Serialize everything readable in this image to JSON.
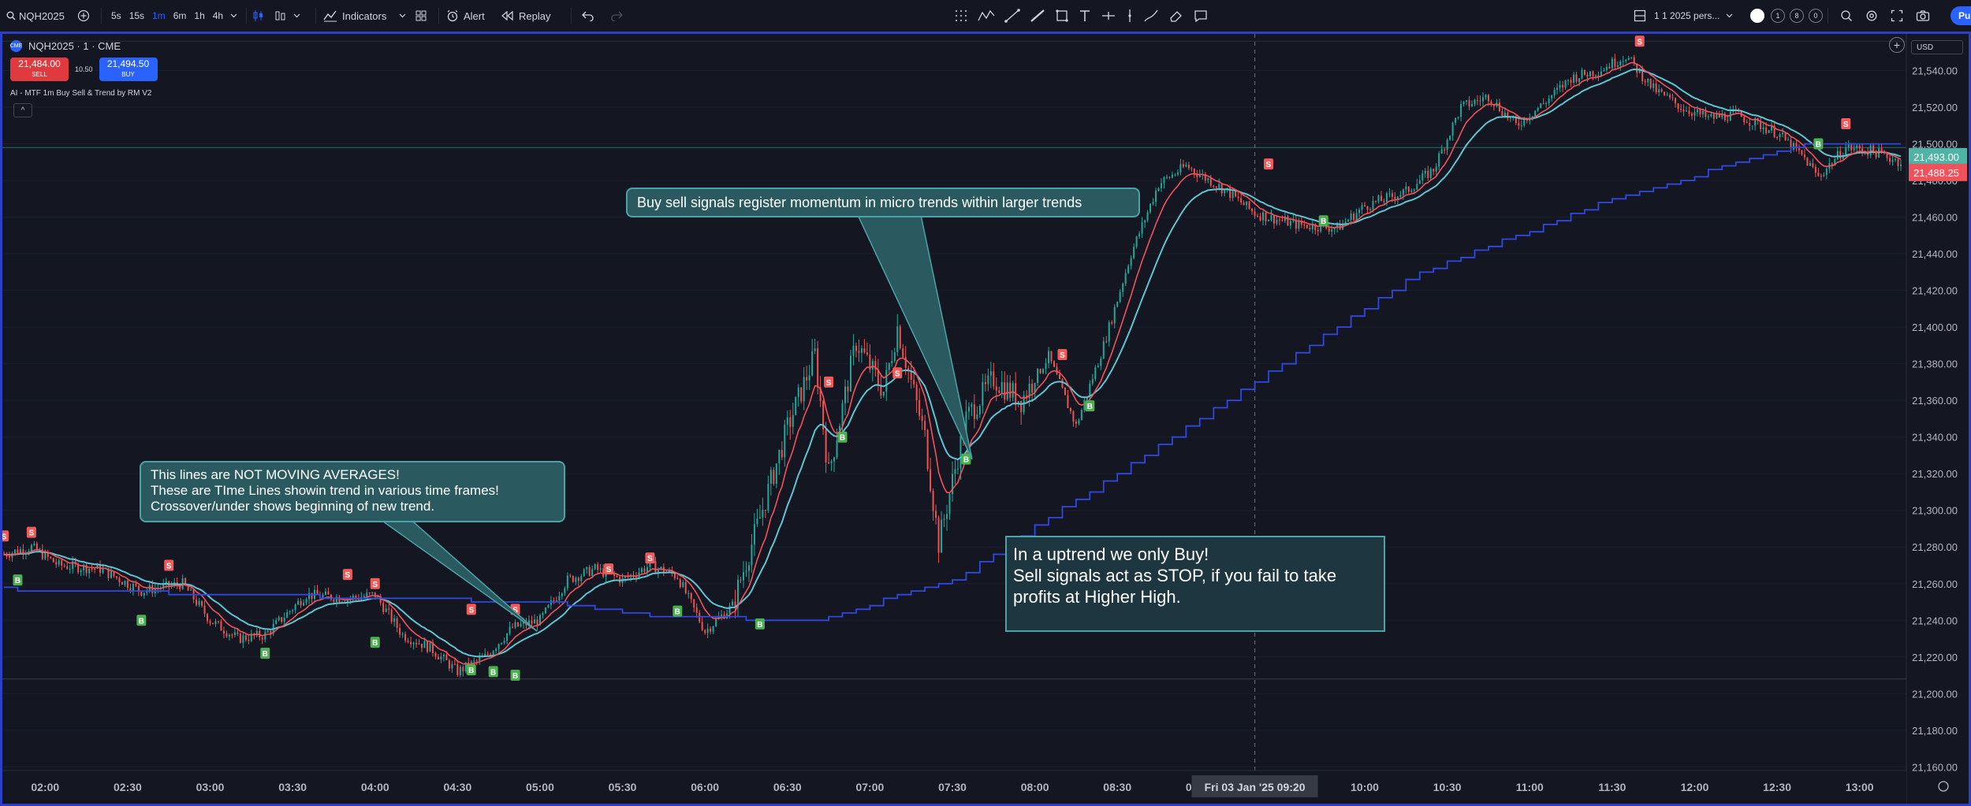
{
  "toolbar": {
    "symbol": "NQH2025",
    "timeframes": [
      "5s",
      "15s",
      "1m",
      "6m",
      "1h",
      "4h"
    ],
    "active_timeframe": "1m",
    "indicators_label": "Indicators",
    "alert_label": "Alert",
    "replay_label": "Replay",
    "layout_label": "1 1 2025 pers...",
    "layout_counts": [
      "1",
      "8",
      "0"
    ],
    "publish_label": "Pu"
  },
  "legend": {
    "symbol_title": "NQH2025 · 1 · CME",
    "sell_price": "21,484.00",
    "sell_label": "SELL",
    "spread": "10.50",
    "buy_price": "21,494.50",
    "buy_label": "BUY",
    "indicator": "AI - MTF 1m Buy Sell & Trend by RM V2",
    "collapse_icon": "^"
  },
  "currency": "USD",
  "price_badges": {
    "cyan": {
      "value": 21493.0,
      "text": "21,493.00"
    },
    "red": {
      "value": 21488.25,
      "text": "21,488.25"
    }
  },
  "crosshair_label": "Fri 03 Jan '25  09:20",
  "callouts": {
    "lines": [
      "This lines are NOT MOVING AVERAGES!",
      "These are TIme Lines showin trend in various time frames!",
      "Crossover/under shows beginning of new trend."
    ],
    "signals": "Buy sell signals register momentum in micro trends within larger trends",
    "uptrend": [
      "In a uptrend we only Buy!",
      "Sell signals act as STOP, if you fail to take",
      "profits at Higher High."
    ]
  },
  "colors": {
    "background": "#141722",
    "up_candle": "#26a69a",
    "down_candle": "#ef5350",
    "red_line": "#f0525b",
    "cyan_line": "#5fc4cf",
    "blue_line": "#3048e0",
    "buy_marker": "#4caf50",
    "sell_marker": "#f05a5a"
  },
  "chart_data": {
    "type": "line",
    "y_axis": {
      "ticks": [
        21540,
        21520,
        21500,
        21480,
        21460,
        21440,
        21420,
        21400,
        21380,
        21360,
        21340,
        21320,
        21300,
        21280,
        21260,
        21240,
        21220,
        21200,
        21180,
        21160
      ],
      "tick_labels": [
        "21,540.00",
        "21,520.00",
        "21,500.00",
        "21,480.00",
        "21,460.00",
        "21,440.00",
        "21,420.00",
        "21,400.00",
        "21,380.00",
        "21,360.00",
        "21,340.00",
        "21,320.00",
        "21,300.00",
        "21,280.00",
        "21,260.00",
        "21,240.00",
        "21,220.00",
        "21,200.00",
        "21,180.00",
        "21,160.00"
      ],
      "range": [
        21158,
        21560
      ]
    },
    "x_axis": {
      "ticks": [
        "02:00",
        "02:30",
        "03:00",
        "03:30",
        "04:00",
        "04:30",
        "05:00",
        "05:30",
        "06:00",
        "06:30",
        "07:00",
        "07:30",
        "08:00",
        "08:30",
        "09:00",
        "10:00",
        "10:30",
        "11:00",
        "11:30",
        "12:00",
        "12:30",
        "13:00"
      ]
    },
    "horizontal_lines": [
      21498,
      21208
    ],
    "price_path": [
      [
        "01:45",
        21276
      ],
      [
        "01:55",
        21280
      ],
      [
        "02:05",
        21270
      ],
      [
        "02:20",
        21268
      ],
      [
        "02:35",
        21256
      ],
      [
        "02:50",
        21260
      ],
      [
        "03:00",
        21240
      ],
      [
        "03:10",
        21230
      ],
      [
        "03:20",
        21232
      ],
      [
        "03:35",
        21254
      ],
      [
        "03:50",
        21252
      ],
      [
        "04:00",
        21254
      ],
      [
        "04:10",
        21232
      ],
      [
        "04:20",
        21225
      ],
      [
        "04:30",
        21212
      ],
      [
        "04:40",
        21220
      ],
      [
        "04:50",
        21236
      ],
      [
        "05:00",
        21240
      ],
      [
        "05:10",
        21262
      ],
      [
        "05:20",
        21268
      ],
      [
        "05:30",
        21262
      ],
      [
        "05:40",
        21270
      ],
      [
        "05:50",
        21264
      ],
      [
        "06:00",
        21234
      ],
      [
        "06:10",
        21248
      ],
      [
        "06:20",
        21296
      ],
      [
        "06:30",
        21345
      ],
      [
        "06:40",
        21385
      ],
      [
        "06:45",
        21320
      ],
      [
        "06:55",
        21392
      ],
      [
        "07:05",
        21365
      ],
      [
        "07:10",
        21400
      ],
      [
        "07:20",
        21340
      ],
      [
        "07:25",
        21282
      ],
      [
        "07:35",
        21350
      ],
      [
        "07:45",
        21372
      ],
      [
        "07:55",
        21360
      ],
      [
        "08:05",
        21384
      ],
      [
        "08:15",
        21346
      ],
      [
        "08:25",
        21390
      ],
      [
        "08:35",
        21440
      ],
      [
        "08:45",
        21478
      ],
      [
        "08:55",
        21488
      ],
      [
        "09:10",
        21474
      ],
      [
        "09:20",
        21462
      ],
      [
        "09:35",
        21456
      ],
      [
        "09:50",
        21454
      ],
      [
        "10:00",
        21466
      ],
      [
        "10:15",
        21474
      ],
      [
        "10:25",
        21486
      ],
      [
        "10:35",
        21520
      ],
      [
        "10:45",
        21526
      ],
      [
        "10:55",
        21510
      ],
      [
        "11:05",
        21522
      ],
      [
        "11:15",
        21536
      ],
      [
        "11:25",
        21540
      ],
      [
        "11:35",
        21548
      ],
      [
        "11:45",
        21530
      ],
      [
        "11:55",
        21520
      ],
      [
        "12:05",
        21514
      ],
      [
        "12:15",
        21516
      ],
      [
        "12:30",
        21506
      ],
      [
        "12:40",
        21492
      ],
      [
        "12:45",
        21482
      ],
      [
        "12:55",
        21498
      ],
      [
        "13:05",
        21496
      ],
      [
        "13:15",
        21490
      ]
    ],
    "series": [],
    "buy_signals": [
      [
        "01:50",
        21262
      ],
      [
        "02:35",
        21240
      ],
      [
        "03:20",
        21222
      ],
      [
        "04:00",
        21228
      ],
      [
        "04:35",
        21213
      ],
      [
        "04:43",
        21212
      ],
      [
        "04:51",
        21210
      ],
      [
        "05:50",
        21245
      ],
      [
        "06:20",
        21238
      ],
      [
        "06:50",
        21340
      ],
      [
        "07:35",
        21328
      ],
      [
        "08:20",
        21357
      ],
      [
        "09:45",
        21458
      ],
      [
        "12:45",
        21500
      ]
    ],
    "sell_signals": [
      [
        "01:45",
        21286
      ],
      [
        "01:55",
        21288
      ],
      [
        "02:45",
        21270
      ],
      [
        "03:50",
        21265
      ],
      [
        "04:00",
        21260
      ],
      [
        "04:35",
        21246
      ],
      [
        "04:51",
        21246
      ],
      [
        "05:25",
        21268
      ],
      [
        "05:40",
        21274
      ],
      [
        "06:45",
        21370
      ],
      [
        "07:10",
        21375
      ],
      [
        "08:10",
        21385
      ],
      [
        "09:25",
        21489
      ],
      [
        "11:40",
        21556
      ],
      [
        "12:55",
        21511
      ]
    ]
  }
}
